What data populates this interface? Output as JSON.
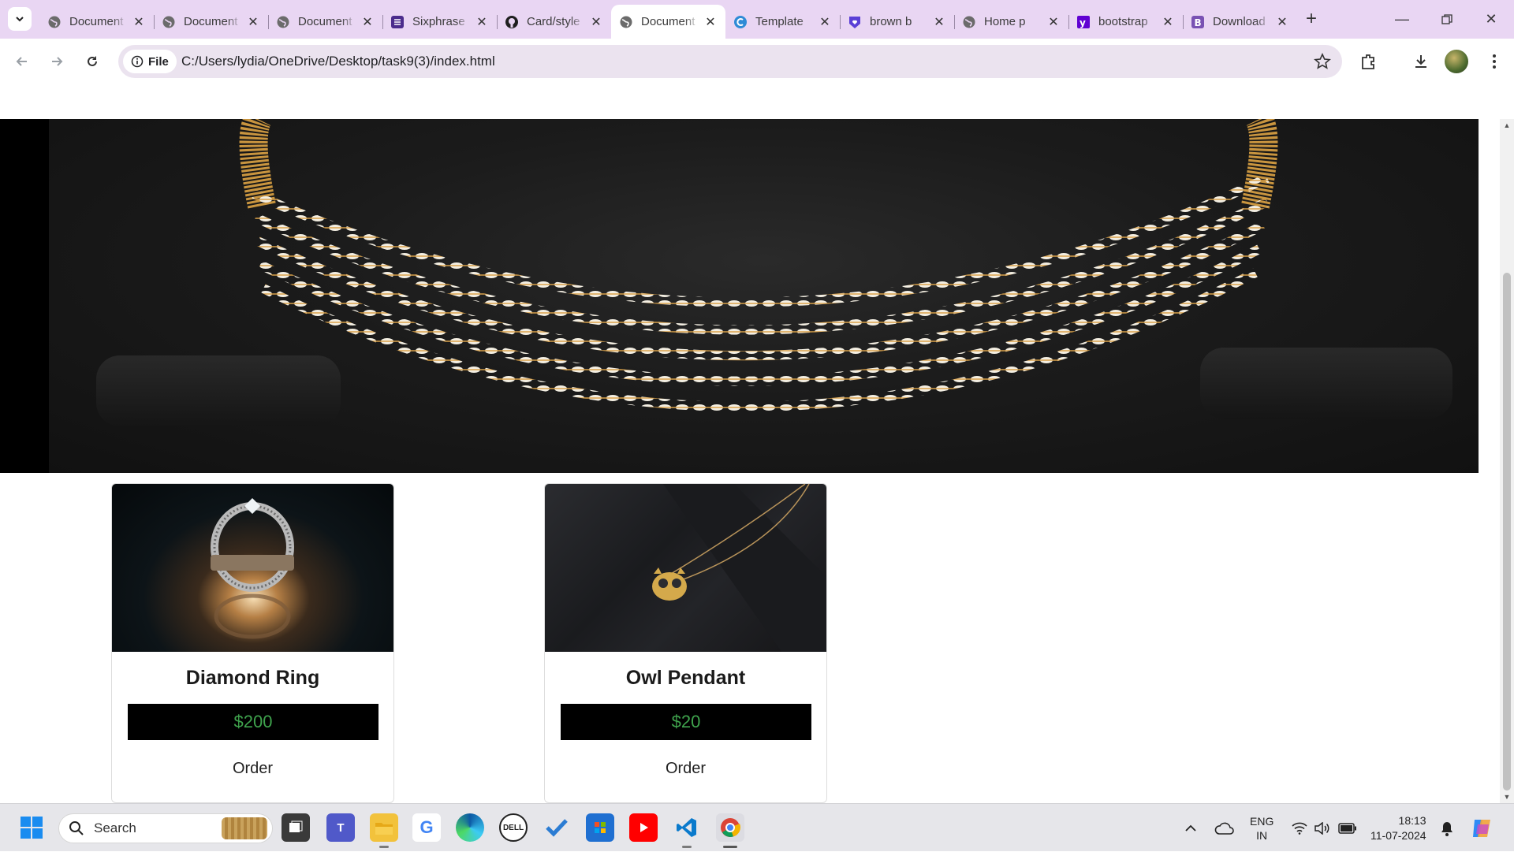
{
  "browser": {
    "tabs": [
      {
        "title": "Document",
        "icon": "globe-icon",
        "active": false
      },
      {
        "title": "Document",
        "icon": "globe-icon",
        "active": false
      },
      {
        "title": "Document",
        "icon": "globe-icon",
        "active": false
      },
      {
        "title": "Sixphrase",
        "icon": "sixphrase-icon",
        "active": false
      },
      {
        "title": "Card/style",
        "icon": "github-icon",
        "active": false
      },
      {
        "title": "Document",
        "icon": "globe-icon",
        "active": true
      },
      {
        "title": "Template",
        "icon": "template-icon",
        "active": false
      },
      {
        "title": "brown b",
        "icon": "heart-shield-icon",
        "active": false
      },
      {
        "title": "Home p",
        "icon": "globe-icon",
        "active": false
      },
      {
        "title": "bootstrap",
        "icon": "yahoo-icon",
        "active": false
      },
      {
        "title": "Download",
        "icon": "bootstrap-icon",
        "active": false
      }
    ],
    "address": {
      "chip_label": "File",
      "url": "C:/Users/lydia/OneDrive/Desktop/task9(3)/index.html"
    }
  },
  "page": {
    "products": [
      {
        "name": "Diamond Ring",
        "price": "$200",
        "action": "Order"
      },
      {
        "name": "Owl Pendant",
        "price": "$20",
        "action": "Order"
      }
    ]
  },
  "taskbar": {
    "search_label": "Search",
    "language_line1": "ENG",
    "language_line2": "IN",
    "time": "18:13",
    "date": "11-07-2024",
    "apps": [
      "windows-start-icon",
      "file-explorer-icon",
      "teams-icon",
      "folder-icon",
      "google-icon",
      "edge-icon",
      "dell-icon",
      "todo-icon",
      "store-icon",
      "youtube-icon",
      "vscode-icon",
      "chrome-icon"
    ]
  },
  "colors": {
    "tabstrip": "#e9d6f3",
    "price_text": "#3fa34d",
    "price_bg": "#000000"
  }
}
